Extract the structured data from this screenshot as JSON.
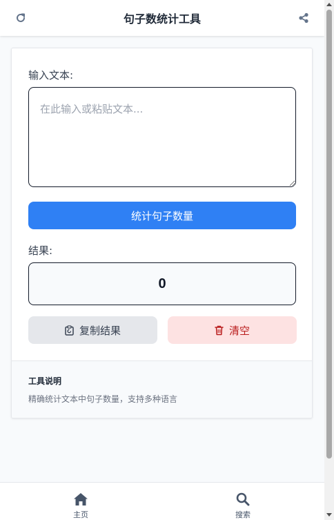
{
  "header": {
    "title": "句子数统计工具",
    "left_icon": "refresh-icon",
    "right_icon": "share-icon"
  },
  "input": {
    "label": "输入文本:",
    "placeholder": "在此输入或粘贴文本...",
    "value": ""
  },
  "actions": {
    "count_label": "统计句子数量",
    "copy_label": "复制结果",
    "copy_icon": "clipboard-icon",
    "clear_label": "清空",
    "clear_icon": "trash-icon"
  },
  "result": {
    "label": "结果:",
    "value": "0"
  },
  "info": {
    "title": "工具说明",
    "text": "精确统计文本中句子数量，支持多种语言"
  },
  "bottom_nav": {
    "items": [
      {
        "label": "主页",
        "icon": "home-icon"
      },
      {
        "label": "搜索",
        "icon": "search-icon"
      }
    ]
  },
  "colors": {
    "primary": "#2f80f4",
    "danger_bg": "#fde2e2",
    "danger_text": "#b91c1c",
    "neutral_bg": "#e5e7eb"
  }
}
